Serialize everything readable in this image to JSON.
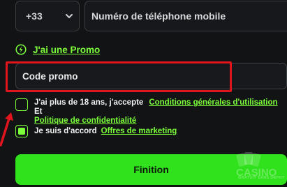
{
  "phone": {
    "country_code": "+33",
    "placeholder": "Numéro de téléphone mobile"
  },
  "promo": {
    "link_label": "J'ai une Promo",
    "code_placeholder": "Code promo"
  },
  "terms": {
    "text_before": "J'ai plus de 18 ans, j'accepte",
    "conditions_link": "Conditions générales d'utilisation",
    "and": "Et",
    "privacy_link": "Politique de confidentialité",
    "checked": false
  },
  "marketing": {
    "text": "Je suis d'accord",
    "link": "Offres de marketing",
    "checked": true
  },
  "submit": {
    "label": "Finition"
  },
  "watermark": {
    "brand": "CASINO",
    "tagline": "GRATUIT SANS DEPOT"
  },
  "colors": {
    "background": "#111315",
    "accent_green": "#7cff3a",
    "button_green": "#2fe21b",
    "highlight_red": "#e0141c"
  }
}
